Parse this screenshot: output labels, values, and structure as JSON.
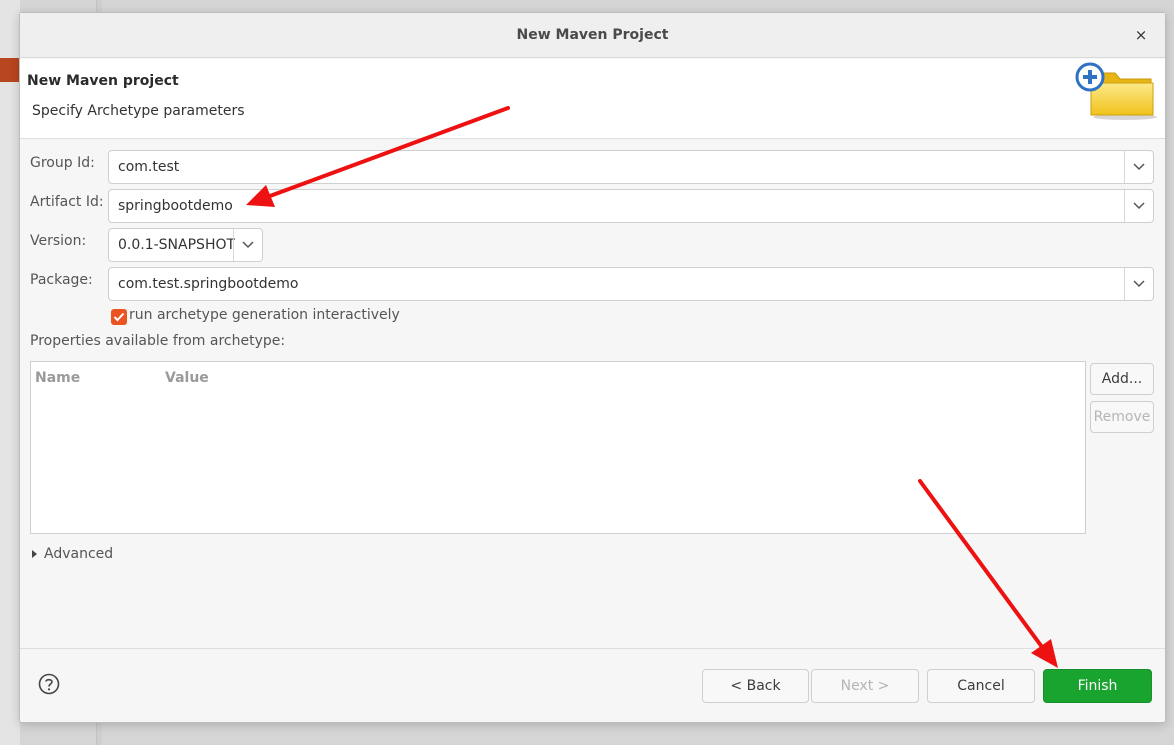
{
  "dialog": {
    "title": "New Maven Project",
    "close_glyph": "×"
  },
  "header": {
    "title": "New Maven project",
    "subtitle": "Specify Archetype parameters",
    "icon": "new-folder-plus-icon"
  },
  "form": {
    "group_id": {
      "label": "Group Id:",
      "value": "com.test"
    },
    "artifact_id": {
      "label": "Artifact Id:",
      "value": "springbootdemo"
    },
    "version": {
      "label": "Version:",
      "value": "0.0.1-SNAPSHOT"
    },
    "package": {
      "label": "Package:",
      "value": "com.test.springbootdemo"
    },
    "interactive": {
      "label": "run archetype generation interactively",
      "checked": true
    }
  },
  "properties": {
    "label": "Properties available from archetype:",
    "columns": [
      "Name",
      "Value"
    ],
    "rows": [],
    "add_label": "Add...",
    "remove_label": "Remove"
  },
  "advanced": {
    "label": "Advanced"
  },
  "buttons": {
    "back": "< Back",
    "next": "Next >",
    "cancel": "Cancel",
    "finish": "Finish"
  },
  "colors": {
    "accent_checkbox": "#e95420",
    "finish_button": "#19a32f",
    "annotation_arrow": "#ee1111"
  }
}
